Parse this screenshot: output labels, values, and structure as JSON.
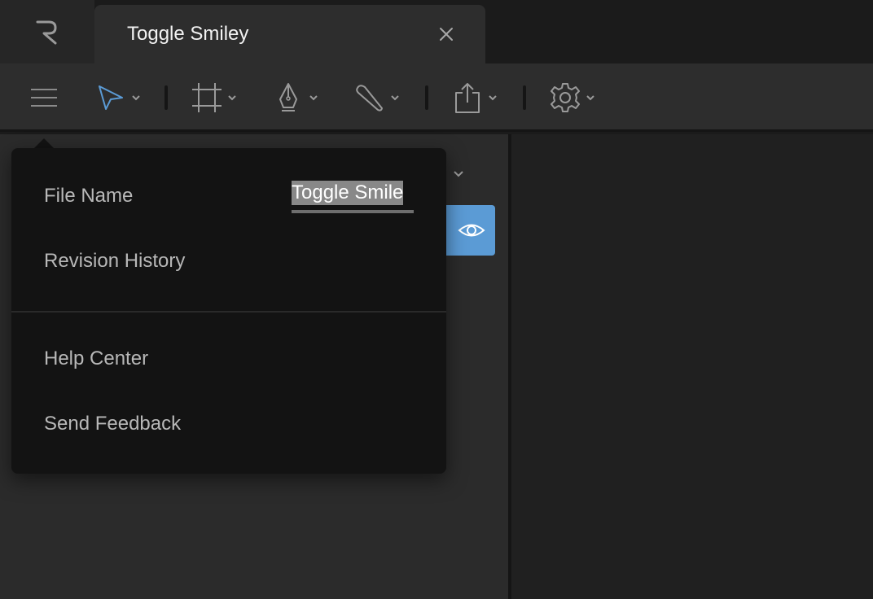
{
  "tab": {
    "title": "Toggle Smiley"
  },
  "toolbar": {
    "tools": [
      "menu-icon",
      "select-icon",
      "frame-icon",
      "pen-icon",
      "brush-icon",
      "export-icon",
      "settings-icon"
    ]
  },
  "menu": {
    "file_name_label": "File Name",
    "file_name_value": "Toggle Smile",
    "revision_history": "Revision History",
    "help_center": "Help Center",
    "send_feedback": "Send Feedback"
  },
  "colors": {
    "accent": "#5b9bd5",
    "panel": "#2d2d2d",
    "menu_bg": "#131313"
  }
}
